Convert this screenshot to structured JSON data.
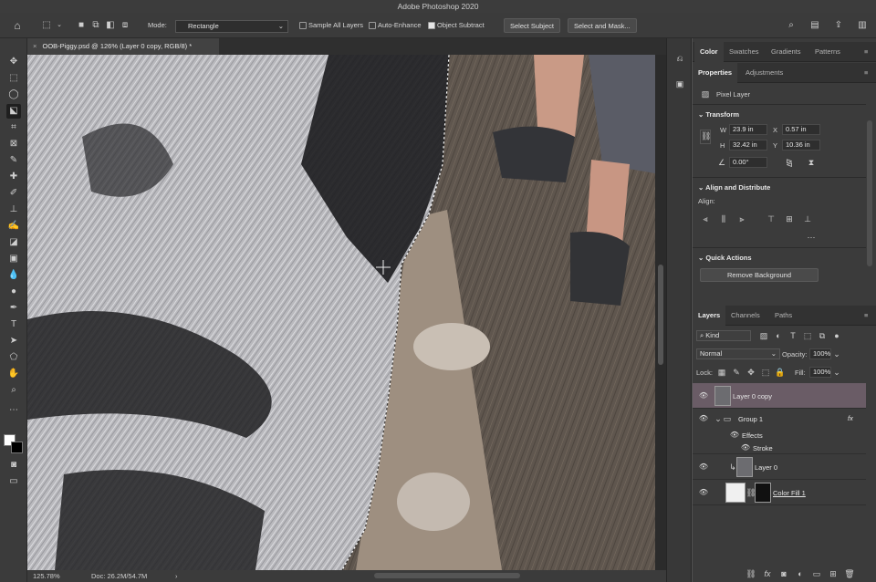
{
  "app": {
    "title": "Adobe Photoshop 2020"
  },
  "options_bar": {
    "mode_label": "Mode:",
    "mode_value": "Rectangle",
    "sample_all_layers": {
      "label": "Sample All Layers",
      "checked": false
    },
    "auto_enhance": {
      "label": "Auto-Enhance",
      "checked": false
    },
    "object_subtract": {
      "label": "Object Subtract",
      "checked": true
    },
    "select_subject": "Select Subject",
    "select_and_mask": "Select and Mask..."
  },
  "document": {
    "tab_title": "OOB-Piggy.psd @ 126% (Layer 0 copy, RGB/8) *"
  },
  "status": {
    "zoom": "125.78%",
    "doc_size": "Doc: 26.2M/54.7M"
  },
  "top_panel": {
    "tabs": [
      "Color",
      "Swatches",
      "Gradients",
      "Patterns"
    ],
    "active": "Color"
  },
  "properties_panel": {
    "tabs": [
      "Properties",
      "Adjustments"
    ],
    "layer_kind": "Pixel Layer",
    "transform": {
      "heading": "Transform",
      "w_label": "W",
      "w": "23.9 in",
      "h_label": "H",
      "h": "32.42 in",
      "x_label": "X",
      "x": "0.57 in",
      "y_label": "Y",
      "y": "10.36 in",
      "angle": "0.00°"
    },
    "align": {
      "heading": "Align and Distribute",
      "label": "Align:"
    },
    "quick_actions": {
      "heading": "Quick Actions",
      "remove_background": "Remove Background"
    }
  },
  "layers_panel": {
    "tabs": [
      "Layers",
      "Channels",
      "Paths"
    ],
    "filter_kind": "Kind",
    "blend_mode": "Normal",
    "opacity_label": "Opacity:",
    "opacity": "100%",
    "lock_label": "Lock:",
    "fill_label": "Fill:",
    "fill": "100%",
    "layers": [
      {
        "name": "Layer 0 copy",
        "selected": true
      },
      {
        "name": "Group 1",
        "fx": "fx"
      },
      {
        "name": "Effects"
      },
      {
        "name": "Stroke"
      },
      {
        "name": "Layer 0"
      },
      {
        "name": "Color Fill 1"
      }
    ]
  },
  "colors": {
    "selected_layer": "#6a5c66",
    "panel_bg": "#3b3b3b",
    "accent": "#6e9ad8"
  }
}
